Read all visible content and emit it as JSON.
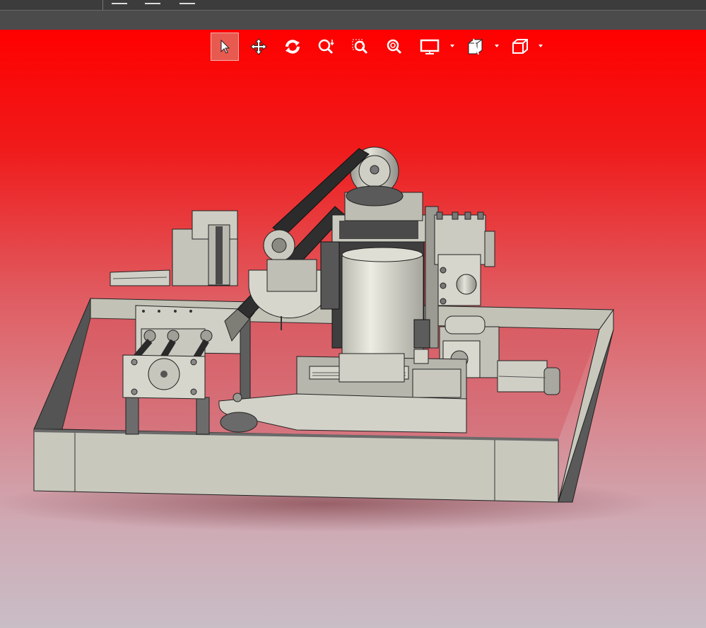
{
  "topbar": {
    "icons": [
      "menu-icon",
      "save-icon",
      "print-icon"
    ]
  },
  "view_toolbar": {
    "buttons": [
      {
        "name": "select-tool",
        "icon": "pointer-arrow-icon",
        "active": true
      },
      {
        "name": "pan-tool",
        "icon": "move-arrows-icon",
        "active": false
      },
      {
        "name": "rotate-tool",
        "icon": "rotate-icon",
        "active": false
      },
      {
        "name": "zoom-dynamic-tool",
        "icon": "zoom-dynamic-icon",
        "active": false
      },
      {
        "name": "zoom-window-tool",
        "icon": "zoom-window-icon",
        "active": false
      },
      {
        "name": "zoom-fit-tool",
        "icon": "zoom-fit-icon",
        "active": false
      },
      {
        "name": "display-mode-tool",
        "icon": "monitor-icon",
        "active": false
      },
      {
        "name": "section-view-tool",
        "icon": "section-view-icon",
        "active": false
      },
      {
        "name": "view-orientation-tool",
        "icon": "cube-icon",
        "active": false
      }
    ]
  },
  "viewport": {
    "background_top": "#ff0000",
    "background_bottom": "#c9bdc6",
    "model_description": "3D CAD assembly"
  }
}
